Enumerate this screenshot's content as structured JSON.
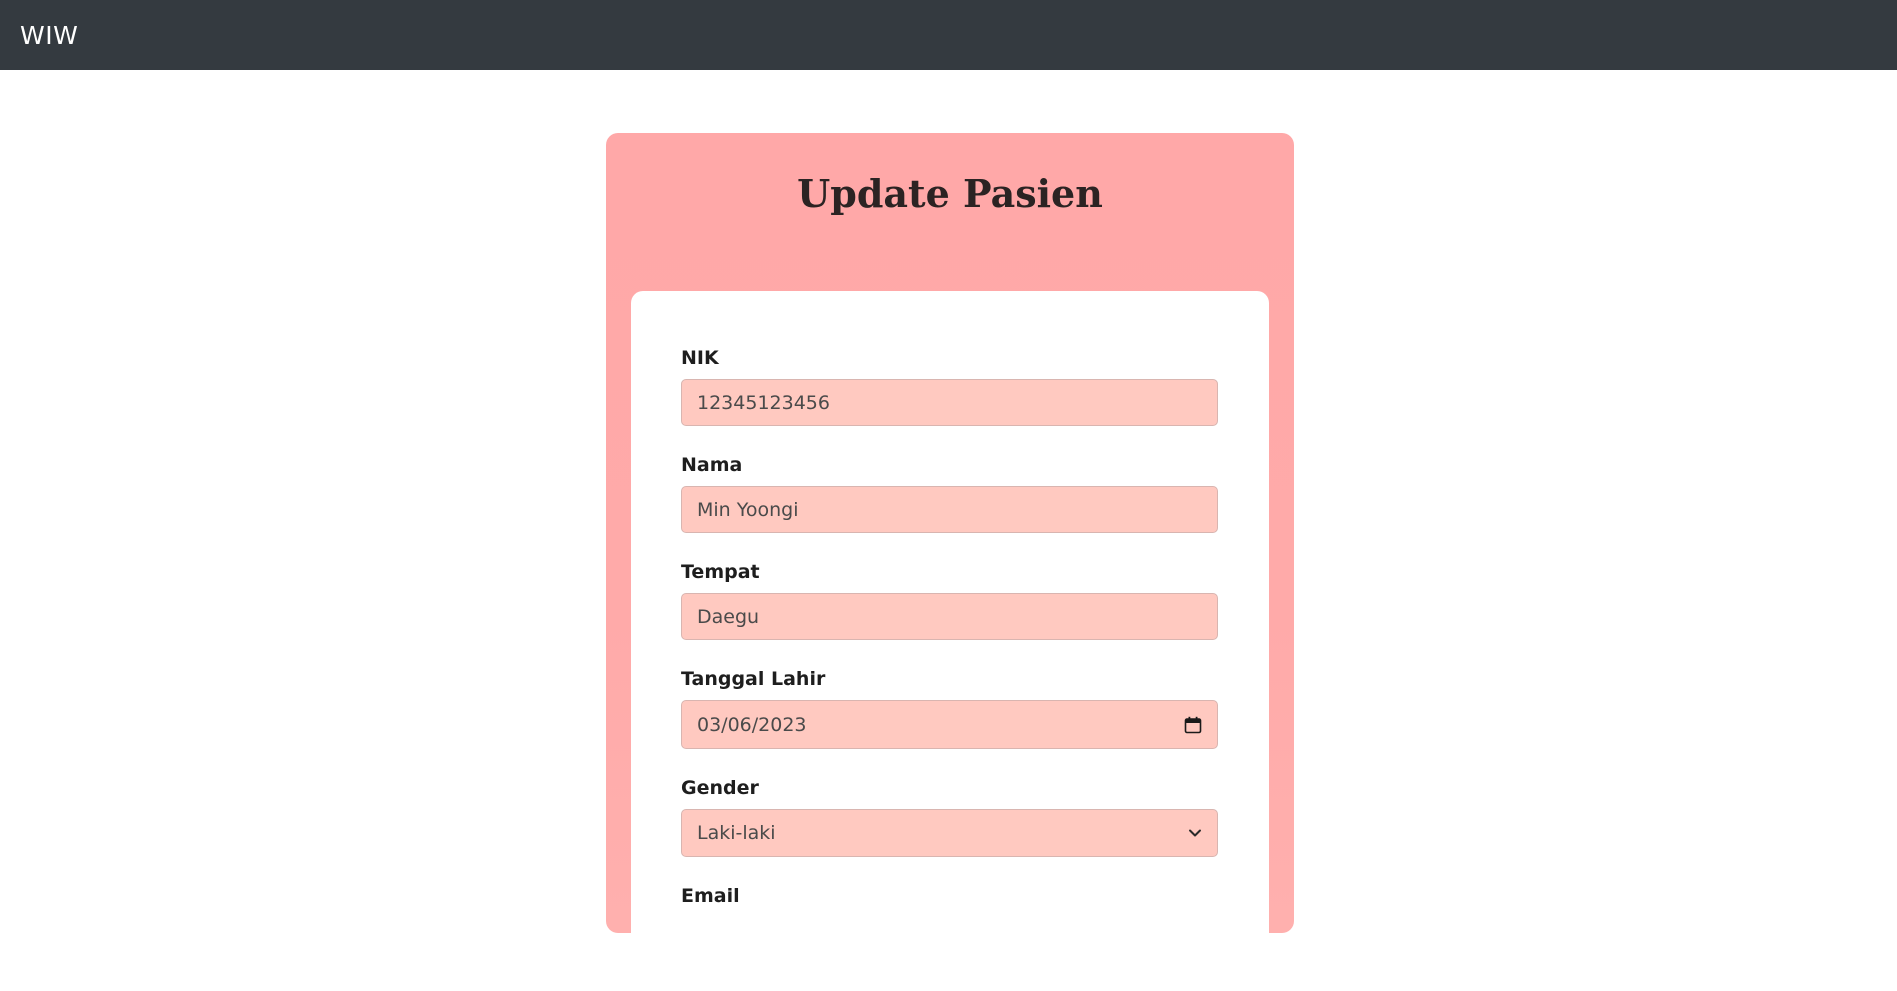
{
  "navbar": {
    "brand": "WIW"
  },
  "form": {
    "title": "Update Pasien",
    "fields": {
      "nik": {
        "label": "NIK",
        "value": "12345123456"
      },
      "nama": {
        "label": "Nama",
        "value": "Min Yoongi"
      },
      "tempat": {
        "label": "Tempat",
        "value": "Daegu"
      },
      "tanggal_lahir": {
        "label": "Tanggal Lahir",
        "value": "03/06/2023"
      },
      "gender": {
        "label": "Gender",
        "selected": "Laki-laki"
      },
      "email": {
        "label": "Email"
      }
    }
  },
  "colors": {
    "navbar_bg": "#343a40",
    "card_bg": "#ffa8a8",
    "input_bg": "#ffc9c0"
  },
  "icons": {
    "date": "calendar-icon",
    "select": "chevron-down-icon"
  }
}
